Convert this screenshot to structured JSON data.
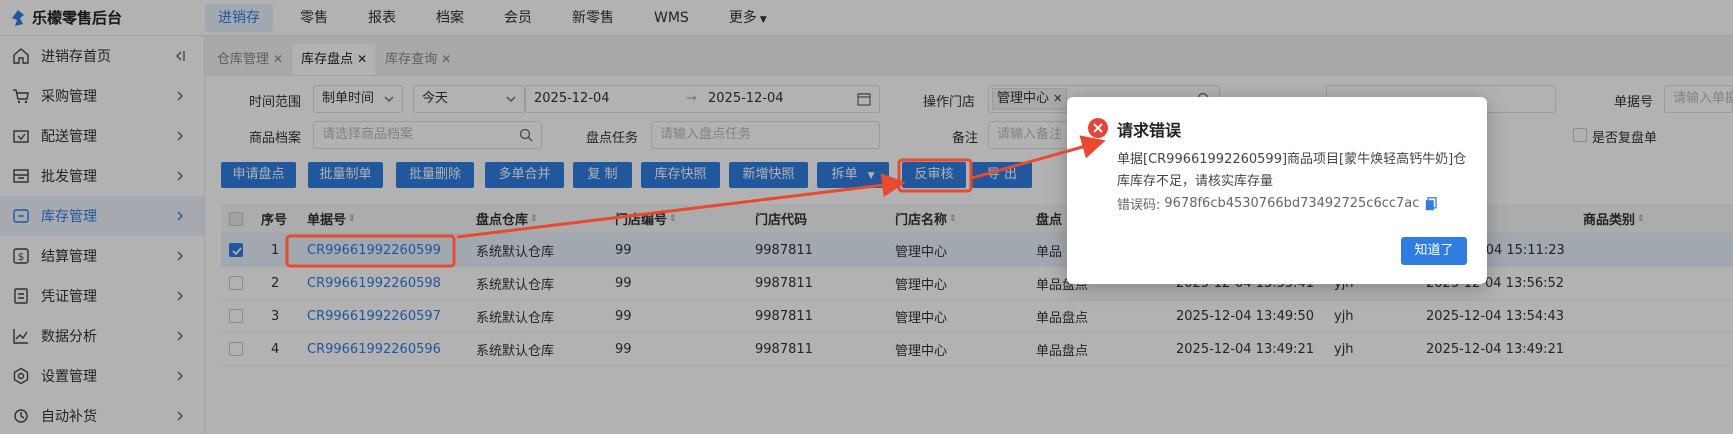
{
  "app": {
    "title": "乐檬零售后台"
  },
  "topnav": [
    "进销存",
    "零售",
    "报表",
    "档案",
    "会员",
    "新零售",
    "WMS",
    "更多"
  ],
  "sidebar": [
    {
      "label": "进销存首页"
    },
    {
      "label": "采购管理"
    },
    {
      "label": "配送管理"
    },
    {
      "label": "批发管理"
    },
    {
      "label": "库存管理"
    },
    {
      "label": "结算管理"
    },
    {
      "label": "凭证管理"
    },
    {
      "label": "数据分析"
    },
    {
      "label": "设置管理"
    },
    {
      "label": "自动补货"
    }
  ],
  "tabs": [
    {
      "label": "仓库管理"
    },
    {
      "label": "库存盘点"
    },
    {
      "label": "库存查询"
    }
  ],
  "filters": {
    "time_range_label": "时间范围",
    "time_type": "制单时间",
    "time_preset": "今天",
    "date_start": "2025-12-04",
    "date_end": "2025-12-04",
    "store_label": "操作门店",
    "store_tag": "管理中心",
    "doc_no_label": "单据号",
    "doc_no_placeholder": "请输入单据",
    "product_label": "商品档案",
    "product_placeholder": "请选择商品档案",
    "task_label": "盘点任务",
    "task_placeholder": "请输入盘点任务",
    "remark_label": "备注",
    "remark_placeholder": "请输入备注",
    "recheck_label": "是否复盘单"
  },
  "buttons": [
    "申请盘点",
    "批量制单",
    "批量删除",
    "多单合并",
    "复 制",
    "库存快照",
    "新增快照",
    "拆单",
    "反审核",
    "导 出"
  ],
  "table": {
    "headers": [
      "序号",
      "单据号",
      "盘点仓库",
      "门店编号",
      "门店代码",
      "门店名称",
      "盘点",
      "商品类别"
    ],
    "rows": [
      {
        "idx": "1",
        "doc": "CR99661992260599",
        "wh": "系统默认仓库",
        "store_no": "99",
        "store_code": "9987811",
        "store_name": "管理中心",
        "type": "单品",
        "created": "",
        "user": "",
        "audited": "-04 15:11:23"
      },
      {
        "idx": "2",
        "doc": "CR99661992260598",
        "wh": "系统默认仓库",
        "store_no": "99",
        "store_code": "9987811",
        "store_name": "管理中心",
        "type": "单品盘点",
        "created": "2025-12-04 13:55:41",
        "user": "yjh",
        "audited": "2025-12-04 13:56:52"
      },
      {
        "idx": "3",
        "doc": "CR99661992260597",
        "wh": "系统默认仓库",
        "store_no": "99",
        "store_code": "9987811",
        "store_name": "管理中心",
        "type": "单品盘点",
        "created": "2025-12-04 13:49:50",
        "user": "yjh",
        "audited": "2025-12-04 13:54:43"
      },
      {
        "idx": "4",
        "doc": "CR99661992260596",
        "wh": "系统默认仓库",
        "store_no": "99",
        "store_code": "9987811",
        "store_name": "管理中心",
        "type": "单品盘点",
        "created": "2025-12-04 13:49:21",
        "user": "yjh",
        "audited": "2025-12-04 13:49:21"
      }
    ]
  },
  "modal": {
    "title": "请求错误",
    "message": "单据[CR99661992260599]商品项目[蒙牛焕轻高钙牛奶]仓库库存不足，请核实库存量",
    "code_label": "错误码:",
    "code": "9678f6cb4530766bd73492725c6cc7ac",
    "ok_label": "知道了"
  },
  "colors": {
    "primary": "#2f7de1",
    "annotation": "#e84a2f",
    "error": "#e8423a"
  }
}
